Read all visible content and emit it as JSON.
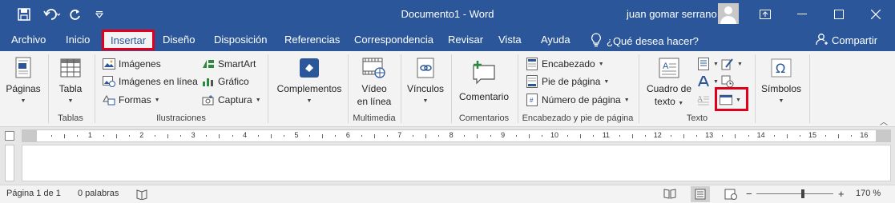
{
  "titlebar": {
    "title": "Documento1  -  Word",
    "user": "juan gomar serrano",
    "colors": {
      "brand": "#2b579a",
      "highlight": "#e0001b"
    }
  },
  "menu": {
    "items": [
      "Archivo",
      "Inicio",
      "Insertar",
      "Diseño",
      "Disposición",
      "Referencias",
      "Correspondencia",
      "Revisar",
      "Vista",
      "Ayuda"
    ],
    "active": "Insertar",
    "tell_me": "¿Qué desea hacer?",
    "share": "Compartir"
  },
  "ribbon": {
    "groups": {
      "tablas": "Tablas",
      "ilustraciones": "Ilustraciones",
      "multimedia": "Multimedia",
      "comentarios": "Comentarios",
      "encabezado": "Encabezado y pie de página",
      "texto": "Texto"
    },
    "paginas": "Páginas",
    "tabla": "Tabla",
    "imagenes": "Imágenes",
    "imagenes_en_linea": "Imágenes en línea",
    "formas": "Formas",
    "smartart": "SmartArt",
    "grafico": "Gráfico",
    "captura": "Captura",
    "complementos": "Complementos",
    "video_line1": "Vídeo",
    "video_line2": "en línea",
    "vinculos": "Vínculos",
    "comentario": "Comentario",
    "encabezado": "Encabezado",
    "pie_de_pagina": "Pie de página",
    "numero_de_pagina": "Número de página",
    "cuadro_line1": "Cuadro de",
    "cuadro_line2": "texto",
    "simbolos": "Símbolos"
  },
  "ruler": {
    "numbers": [
      "1",
      "2",
      "3",
      "4",
      "5",
      "6",
      "7",
      "8",
      "9",
      "10",
      "11",
      "12",
      "13",
      "14",
      "15",
      "16"
    ]
  },
  "status": {
    "page": "Página 1 de 1",
    "words": "0 palabras",
    "zoom": "170 %",
    "zoom_level_percent": 170,
    "minus": "−",
    "plus": "+"
  }
}
